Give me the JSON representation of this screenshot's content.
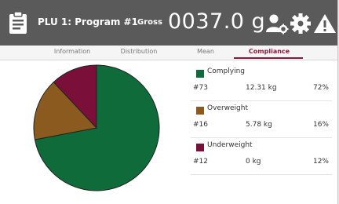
{
  "header": {
    "program": "PLU 1: Program #1",
    "mode": "Gross",
    "weight": "0037.0 g",
    "icons": [
      "clipboard-icon",
      "user-settings-icon",
      "gear-icon",
      "warning-icon"
    ]
  },
  "tabs": [
    {
      "label": "Information",
      "active": false
    },
    {
      "label": "Distribution",
      "active": false
    },
    {
      "label": "Mean",
      "active": false
    },
    {
      "label": "Compliance",
      "active": true
    }
  ],
  "legend": [
    {
      "name": "Complying",
      "count": "#73",
      "weight": "12.31 kg",
      "pct": "72%",
      "color": "#0f6b3a"
    },
    {
      "name": "Overweight",
      "count": "#16",
      "weight": "5.78 kg",
      "pct": "16%",
      "color": "#8b5a1e"
    },
    {
      "name": "Underweight",
      "count": "#12",
      "weight": "0 kg",
      "pct": "12%",
      "color": "#7a1039"
    }
  ],
  "chart_data": {
    "type": "pie",
    "categories": [
      "Complying",
      "Overweight",
      "Underweight"
    ],
    "values": [
      72,
      16,
      12
    ],
    "colors": [
      "#0f6b3a",
      "#8b5a1e",
      "#7a1039"
    ]
  }
}
